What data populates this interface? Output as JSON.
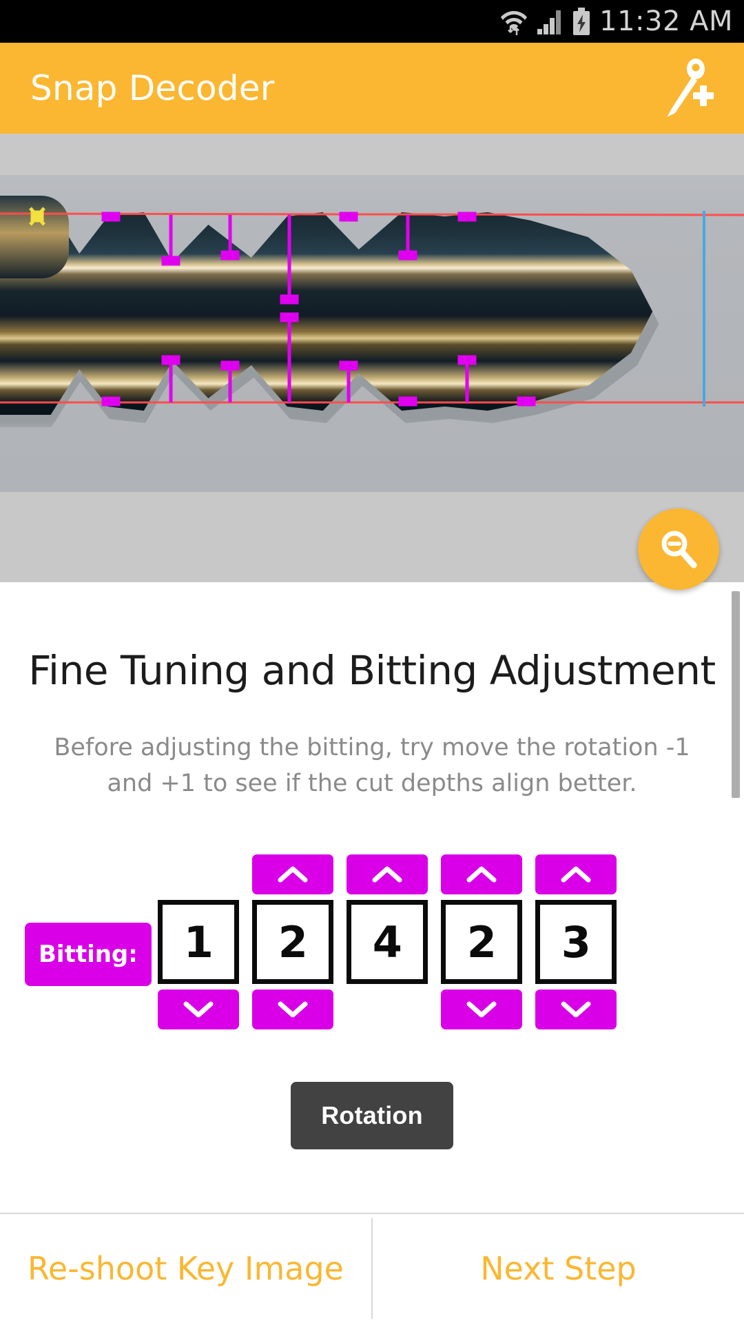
{
  "status_bar": {
    "time": "11:32 AM",
    "icons": [
      "wifi-icon",
      "cellular-signal-icon",
      "battery-charging-icon"
    ]
  },
  "app_bar": {
    "title": "Snap Decoder",
    "action_icon": "add-key-icon"
  },
  "viewer": {
    "fab_icon": "zoom-out-icon",
    "overlay": {
      "guide_line_color": "#ff4d4d",
      "marker_color": "#e000f0",
      "end_line_color": "#4aa8e0",
      "origin_marker_color": "#f0e040"
    }
  },
  "main": {
    "title": "Fine Tuning and Bitting Adjustment",
    "description_line1": "Before adjusting the bitting, try move the rotation -1",
    "description_line2": "and +1 to see if the cut depths align better."
  },
  "bitting": {
    "label": "Bitting:",
    "up_arrow_glyph": "chevron-up-icon",
    "down_arrow_glyph": "chevron-down-icon",
    "columns": [
      {
        "value": "1",
        "has_up": false,
        "has_down": true
      },
      {
        "value": "2",
        "has_up": true,
        "has_down": true
      },
      {
        "value": "4",
        "has_up": true,
        "has_down": false
      },
      {
        "value": "2",
        "has_up": true,
        "has_down": true
      },
      {
        "value": "3",
        "has_up": true,
        "has_down": true
      }
    ]
  },
  "rotation": {
    "label": "Rotation",
    "steps": [
      "",
      "",
      ""
    ]
  },
  "bottom_bar": {
    "left_label": "Re-shoot Key Image",
    "right_label": "Next Step"
  },
  "colors": {
    "accent": "#fbb731",
    "magenta": "#d900e8",
    "dark_button": "#424242",
    "status_bar": "#000000",
    "viewer_bg": "#c8c8c8"
  }
}
